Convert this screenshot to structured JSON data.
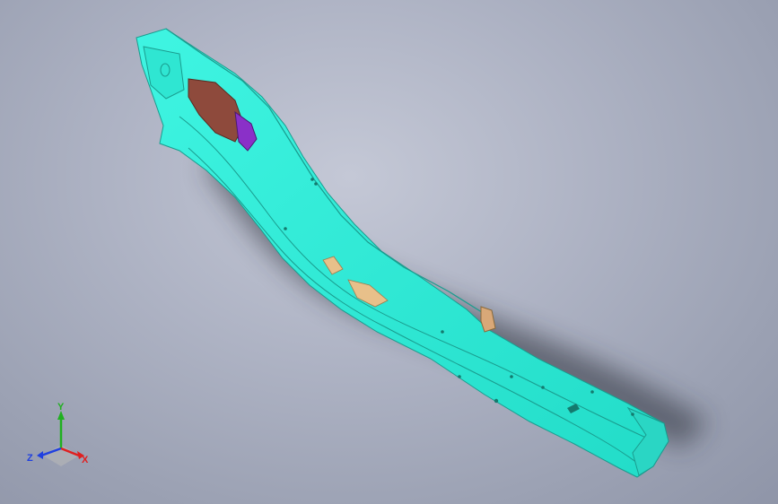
{
  "viewport": {
    "background_top": "#c4c8d6",
    "background_bottom": "#8f95a8"
  },
  "model": {
    "part_color": "#30f0dc",
    "part_edge_color": "#1a9c8e",
    "reinforcement_color": "#8e4a3c",
    "inner_panel_color": "#8a30c8",
    "foam_patch_color": "#e8c08a",
    "bracket_color": "#d9a878"
  },
  "triad": {
    "x_label": "X",
    "y_label": "Y",
    "z_label": "Z",
    "x_color": "#e02020",
    "y_color": "#20b020",
    "z_color": "#2040e0"
  }
}
